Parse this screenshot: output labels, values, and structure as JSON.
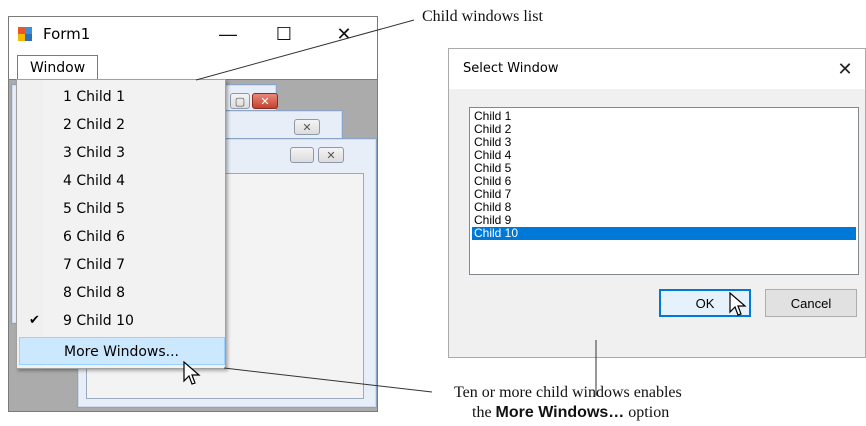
{
  "form1": {
    "title": "Form1",
    "minimize_glyph": "—",
    "maximize_glyph": "☐",
    "close_glyph": "✕",
    "menu_label": "Window"
  },
  "window_menu": {
    "items": [
      {
        "label": "1 Child 1",
        "checked": false
      },
      {
        "label": "2 Child 2",
        "checked": false
      },
      {
        "label": "3 Child 3",
        "checked": false
      },
      {
        "label": "4 Child 4",
        "checked": false
      },
      {
        "label": "5 Child 5",
        "checked": false
      },
      {
        "label": "6 Child 6",
        "checked": false
      },
      {
        "label": "7 Child 7",
        "checked": false
      },
      {
        "label": "8 Child 8",
        "checked": false
      },
      {
        "label": "9 Child 10",
        "checked": true
      },
      {
        "label": "More Windows...",
        "checked": false,
        "highlighted": true
      }
    ],
    "check_glyph": "✔"
  },
  "select_dialog": {
    "title": "Select Window",
    "close_glyph": "✕",
    "list_items": [
      "Child 1",
      "Child 2",
      "Child 3",
      "Child 4",
      "Child 5",
      "Child 6",
      "Child 7",
      "Child 8",
      "Child 9",
      "Child 10"
    ],
    "selected_item": "Child 10",
    "ok_label": "OK",
    "cancel_label": "Cancel"
  },
  "callouts": {
    "child_list": "Child windows list",
    "more_windows_line1": "Ten or more child windows enables",
    "more_windows_line2_prefix": "the ",
    "more_windows_line2_bold": "More Windows…",
    "more_windows_line2_suffix": " option"
  },
  "colors": {
    "selection_blue": "#0078d7",
    "menu_highlight": "#cce8ff",
    "mdi_background": "#ababab"
  }
}
